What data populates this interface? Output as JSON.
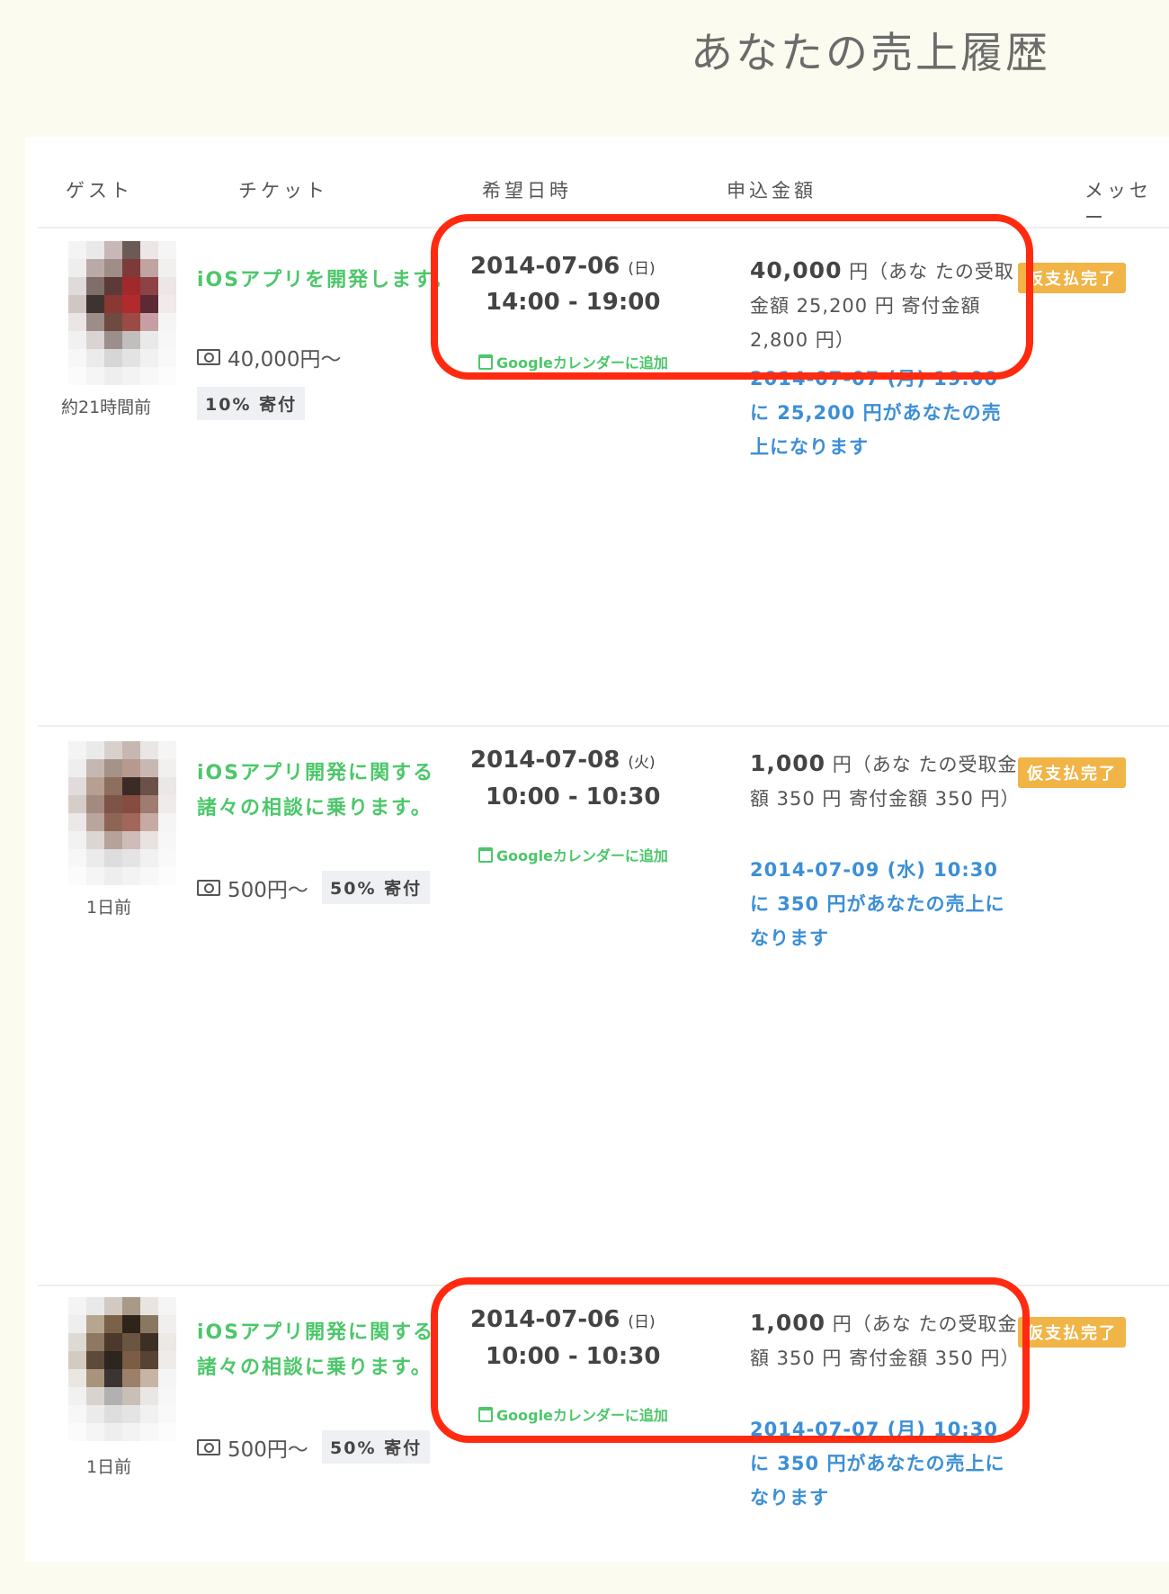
{
  "page": {
    "title": "あなたの売上履歴"
  },
  "table": {
    "headers": [
      "ゲスト",
      "チケット",
      "希望日時",
      "申込金額",
      "メッセー"
    ],
    "rows": [
      {
        "time_ago": "約21時間前",
        "ticket_title": "iOSアプリを開発します。",
        "price": "40,000円〜",
        "donation": "10% 寄付",
        "date": "2014-07-06",
        "weekday": "(日)",
        "time": "14:00 - 19:00",
        "gcal_label": "Googleカレンダーに追加",
        "amount": "40,000",
        "amount_detail": "円（あな たの受取金額 25,200 円 寄付金額 2,800 円）",
        "sales_note": "2014-07-07 (月) 19:00 に 25,200 円があなたの売上になります",
        "status": "仮支払完了"
      },
      {
        "time_ago": "1日前",
        "ticket_title": "iOSアプリ開発に関する諸々の相談に乗ります。",
        "price": "500円〜",
        "donation": "50% 寄付",
        "date": "2014-07-08",
        "weekday": "(火)",
        "time": "10:00 - 10:30",
        "gcal_label": "Googleカレンダーに追加",
        "amount": "1,000",
        "amount_detail": "円（あな たの受取金額 350 円 寄付金額 350 円）",
        "sales_note": "2014-07-09 (水) 10:30 に 350 円があなたの売上になります",
        "status": "仮支払完了"
      },
      {
        "time_ago": "1日前",
        "ticket_title": "iOSアプリ開発に関する諸々の相談に乗ります。",
        "price": "500円〜",
        "donation": "50% 寄付",
        "date": "2014-07-06",
        "weekday": "(日)",
        "time": "10:00 - 10:30",
        "gcal_label": "Googleカレンダーに追加",
        "amount": "1,000",
        "amount_detail": "円（あな たの受取金額 350 円 寄付金額 350 円）",
        "sales_note": "2014-07-07 (月) 10:30 に 350 円があなたの売上になります",
        "status": "仮支払完了"
      }
    ]
  },
  "colors": {
    "accent_green": "#4cc76a",
    "link_blue": "#3c8fd6",
    "status_orange": "#f0b447",
    "highlight_red": "#ff2a0f",
    "page_background": "#fbfbef"
  },
  "icons": {
    "price": "money-icon",
    "calendar": "calendar-icon"
  }
}
